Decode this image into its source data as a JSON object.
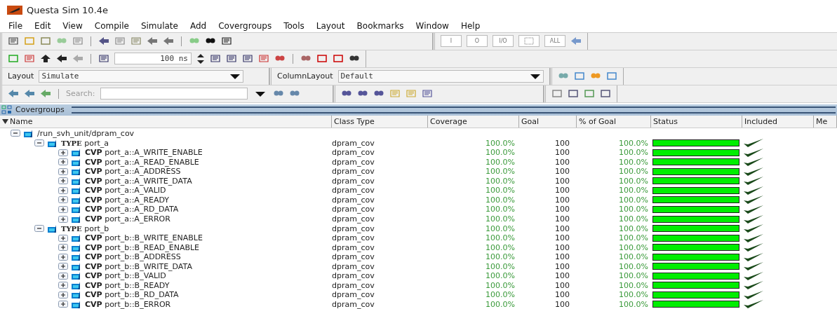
{
  "window": {
    "title": "Questa Sim 10.4e"
  },
  "menu": [
    "File",
    "Edit",
    "View",
    "Compile",
    "Simulate",
    "Add",
    "Covergroups",
    "Tools",
    "Layout",
    "Bookmarks",
    "Window",
    "Help"
  ],
  "toolbar": {
    "port_filters": [
      "I",
      "O",
      "I/O",
      "ALL"
    ],
    "run_length": "100 ns",
    "layout_label": "Layout",
    "layout_value": "Simulate",
    "column_layout_label": "ColumnLayout",
    "column_layout_value": "Default",
    "search_label": "Search:"
  },
  "panel": {
    "title": "Covergroups",
    "columns": [
      "Name",
      "Class Type",
      "Coverage",
      "Goal",
      "% of Goal",
      "Status",
      "Included",
      "Me"
    ],
    "tree": [
      {
        "kind": "instance",
        "name": "/run_svh_unit/dpram_cov",
        "expanded": true,
        "children": [
          {
            "kind": "type",
            "prefix": "TYPE",
            "name": "port_a",
            "expanded": true,
            "class_type": "dpram_cov",
            "coverage": "100.0%",
            "goal": "100",
            "pct_goal": "100.0%",
            "level": 1,
            "included": true,
            "children": [
              {
                "kind": "cvp",
                "prefix": "CVP",
                "name": "port_a::A_WRITE_ENABLE",
                "expanded": false,
                "class_type": "dpram_cov",
                "coverage": "100.0%",
                "goal": "100",
                "pct_goal": "100.0%",
                "level": 1,
                "included": true
              },
              {
                "kind": "cvp",
                "prefix": "CVP",
                "name": "port_a::A_READ_ENABLE",
                "expanded": false,
                "class_type": "dpram_cov",
                "coverage": "100.0%",
                "goal": "100",
                "pct_goal": "100.0%",
                "level": 1,
                "included": true
              },
              {
                "kind": "cvp",
                "prefix": "CVP",
                "name": "port_a::A_ADDRESS",
                "expanded": false,
                "class_type": "dpram_cov",
                "coverage": "100.0%",
                "goal": "100",
                "pct_goal": "100.0%",
                "level": 1,
                "included": true
              },
              {
                "kind": "cvp",
                "prefix": "CVP",
                "name": "port_a::A_WRITE_DATA",
                "expanded": false,
                "class_type": "dpram_cov",
                "coverage": "100.0%",
                "goal": "100",
                "pct_goal": "100.0%",
                "level": 1,
                "included": true
              },
              {
                "kind": "cvp",
                "prefix": "CVP",
                "name": "port_a::A_VALID",
                "expanded": false,
                "class_type": "dpram_cov",
                "coverage": "100.0%",
                "goal": "100",
                "pct_goal": "100.0%",
                "level": 1,
                "included": true
              },
              {
                "kind": "cvp",
                "prefix": "CVP",
                "name": "port_a::A_READY",
                "expanded": false,
                "class_type": "dpram_cov",
                "coverage": "100.0%",
                "goal": "100",
                "pct_goal": "100.0%",
                "level": 1,
                "included": true
              },
              {
                "kind": "cvp",
                "prefix": "CVP",
                "name": "port_a::A_RD_DATA",
                "expanded": false,
                "class_type": "dpram_cov",
                "coverage": "100.0%",
                "goal": "100",
                "pct_goal": "100.0%",
                "level": 1,
                "included": true
              },
              {
                "kind": "cvp",
                "prefix": "CVP",
                "name": "port_a::A_ERROR",
                "expanded": false,
                "class_type": "dpram_cov",
                "coverage": "100.0%",
                "goal": "100",
                "pct_goal": "100.0%",
                "level": 1,
                "included": true
              }
            ]
          },
          {
            "kind": "type",
            "prefix": "TYPE",
            "name": "port_b",
            "expanded": true,
            "class_type": "dpram_cov",
            "coverage": "100.0%",
            "goal": "100",
            "pct_goal": "100.0%",
            "level": 1,
            "included": true,
            "children": [
              {
                "kind": "cvp",
                "prefix": "CVP",
                "name": "port_b::B_WRITE_ENABLE",
                "expanded": false,
                "class_type": "dpram_cov",
                "coverage": "100.0%",
                "goal": "100",
                "pct_goal": "100.0%",
                "level": 1,
                "included": true
              },
              {
                "kind": "cvp",
                "prefix": "CVP",
                "name": "port_b::B_READ_ENABLE",
                "expanded": false,
                "class_type": "dpram_cov",
                "coverage": "100.0%",
                "goal": "100",
                "pct_goal": "100.0%",
                "level": 1,
                "included": true
              },
              {
                "kind": "cvp",
                "prefix": "CVP",
                "name": "port_b::B_ADDRESS",
                "expanded": false,
                "class_type": "dpram_cov",
                "coverage": "100.0%",
                "goal": "100",
                "pct_goal": "100.0%",
                "level": 1,
                "included": true
              },
              {
                "kind": "cvp",
                "prefix": "CVP",
                "name": "port_b::B_WRITE_DATA",
                "expanded": false,
                "class_type": "dpram_cov",
                "coverage": "100.0%",
                "goal": "100",
                "pct_goal": "100.0%",
                "level": 1,
                "included": true
              },
              {
                "kind": "cvp",
                "prefix": "CVP",
                "name": "port_b::B_VALID",
                "expanded": false,
                "class_type": "dpram_cov",
                "coverage": "100.0%",
                "goal": "100",
                "pct_goal": "100.0%",
                "level": 1,
                "included": true
              },
              {
                "kind": "cvp",
                "prefix": "CVP",
                "name": "port_b::B_READY",
                "expanded": false,
                "class_type": "dpram_cov",
                "coverage": "100.0%",
                "goal": "100",
                "pct_goal": "100.0%",
                "level": 1,
                "included": true
              },
              {
                "kind": "cvp",
                "prefix": "CVP",
                "name": "port_b::B_RD_DATA",
                "expanded": false,
                "class_type": "dpram_cov",
                "coverage": "100.0%",
                "goal": "100",
                "pct_goal": "100.0%",
                "level": 1,
                "included": true
              },
              {
                "kind": "cvp",
                "prefix": "CVP",
                "name": "port_b::B_ERROR",
                "expanded": false,
                "class_type": "dpram_cov",
                "coverage": "100.0%",
                "goal": "100",
                "pct_goal": "100.0%",
                "level": 1,
                "included": true
              }
            ]
          }
        ]
      }
    ]
  }
}
